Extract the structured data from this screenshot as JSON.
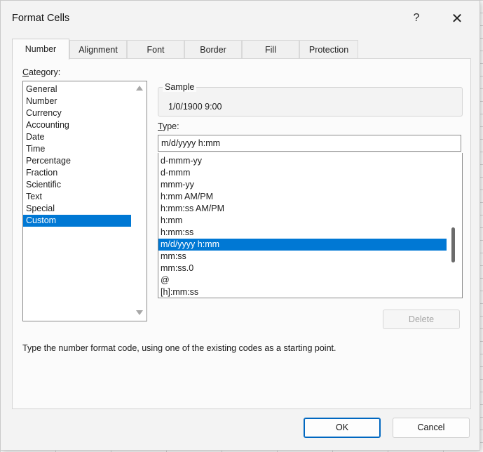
{
  "dialog": {
    "title": "Format Cells",
    "help_glyph": "?",
    "close_glyph": "✕"
  },
  "tabs": [
    {
      "label": "Number",
      "active": true
    },
    {
      "label": "Alignment"
    },
    {
      "label": "Font"
    },
    {
      "label": "Border"
    },
    {
      "label": "Fill"
    },
    {
      "label": "Protection"
    }
  ],
  "category": {
    "label_prefix": "",
    "label_mnemonic": "C",
    "label_rest": "ategory:",
    "items": [
      "General",
      "Number",
      "Currency",
      "Accounting",
      "Date",
      "Time",
      "Percentage",
      "Fraction",
      "Scientific",
      "Text",
      "Special",
      "Custom"
    ],
    "selected": "Custom"
  },
  "sample": {
    "legend": "Sample",
    "value": "1/0/1900 9:00"
  },
  "type": {
    "label_mnemonic": "T",
    "label_rest": "ype:",
    "value": "m/d/yyyy h:mm",
    "items": [
      "d-mmm-yy",
      "d-mmm",
      "mmm-yy",
      "h:mm AM/PM",
      "h:mm:ss AM/PM",
      "h:mm",
      "h:mm:ss",
      "m/d/yyyy h:mm",
      "mm:ss",
      "mm:ss.0",
      "@",
      "[h]:mm:ss"
    ],
    "selected": "m/d/yyyy h:mm"
  },
  "delete_label": "Delete",
  "description": "Type the number format code, using one of the existing codes as a starting point.",
  "footer": {
    "ok_label": "OK",
    "cancel_label": "Cancel"
  },
  "colors": {
    "accent": "#0078d4",
    "ok_border": "#0067c0"
  }
}
